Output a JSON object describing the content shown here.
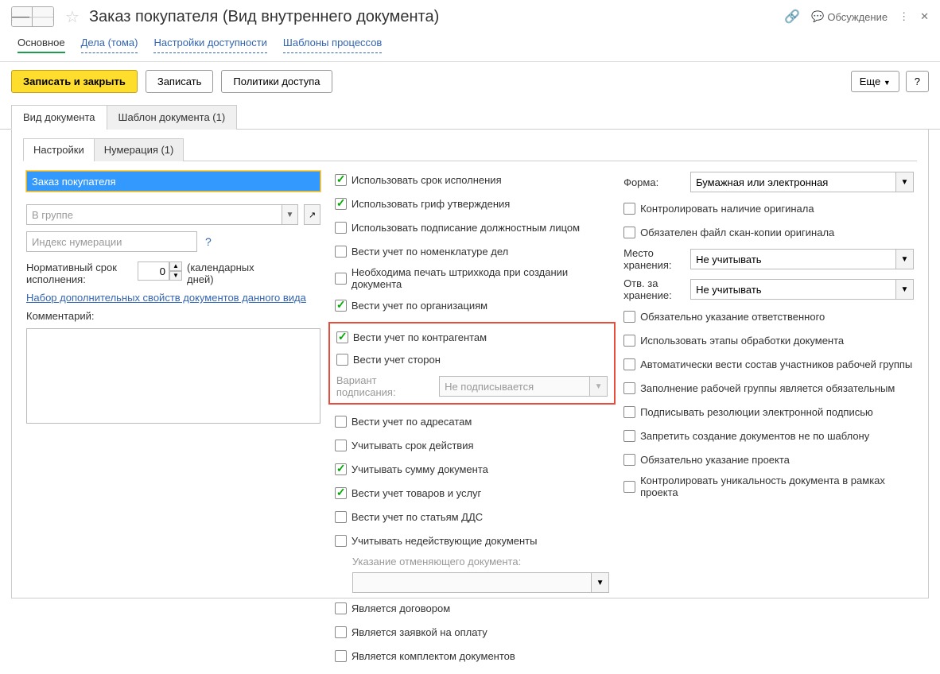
{
  "title": "Заказ покупателя (Вид внутреннего документа)",
  "discussion": "Обсуждение",
  "top_tabs": {
    "main": "Основное",
    "cases": "Дела (тома)",
    "access": "Настройки доступности",
    "templates": "Шаблоны процессов"
  },
  "toolbar": {
    "save_close": "Записать и закрыть",
    "save": "Записать",
    "policies": "Политики доступа",
    "more": "Еще",
    "help": "?"
  },
  "main_tabs": {
    "doc_kind": "Вид документа",
    "doc_template": "Шаблон документа (1)"
  },
  "sub_tabs": {
    "settings": "Настройки",
    "numbering": "Нумерация (1)"
  },
  "col1": {
    "name_value": "Заказ покупателя",
    "group_placeholder": "В группе",
    "index_placeholder": "Индекс нумерации",
    "norm_term_label": "Нормативный срок исполнения:",
    "norm_term_value": "0",
    "norm_term_unit": "(календарных дней)",
    "props_link": "Набор дополнительных свойств документов данного вида",
    "comment_label": "Комментарий:"
  },
  "col2": {
    "use_deadline": "Использовать срок исполнения",
    "use_stamp": "Использовать гриф утверждения",
    "use_signing": "Использовать подписание должностным лицом",
    "nomenclature": "Вести учет по номенклатуре дел",
    "barcode": "Необходима печать штрихкода при создании документа",
    "by_org": "Вести учет по организациям",
    "by_contragent": "Вести учет по контрагентам",
    "by_parties": "Вести учет сторон",
    "sign_variant_label": "Вариант подписания:",
    "sign_variant_value": "Не подписывается",
    "by_addressee": "Вести учет по адресатам",
    "validity": "Учитывать срок действия",
    "amount": "Учитывать сумму документа",
    "goods": "Вести учет товаров и услуг",
    "dds": "Вести учет по статьям ДДС",
    "inactive_docs": "Учитывать недействующие документы",
    "cancel_doc_label": "Указание отменяющего документа:",
    "is_contract": "Является договором",
    "is_payment": "Является заявкой на оплату",
    "is_set": "Является комплектом документов"
  },
  "col3": {
    "form_label": "Форма:",
    "form_value": "Бумажная или электронная",
    "control_original": "Контролировать наличие оригинала",
    "scan_required": "Обязателен файл скан-копии оригинала",
    "storage_label": "Место хранения:",
    "storage_value": "Не учитывать",
    "resp_storage_label": "Отв. за хранение:",
    "resp_storage_value": "Не учитывать",
    "responsible_required": "Обязательно указание ответственного",
    "use_stages": "Использовать этапы обработки документа",
    "auto_workgroup": "Автоматически вести состав участников рабочей группы",
    "workgroup_required": "Заполнение рабочей группы является обязательным",
    "sign_resolutions": "Подписывать резолюции электронной подписью",
    "forbid_no_template": "Запретить создание документов не по шаблону",
    "project_required": "Обязательно указание проекта",
    "unique_in_project": "Контролировать уникальность документа в рамках проекта"
  }
}
